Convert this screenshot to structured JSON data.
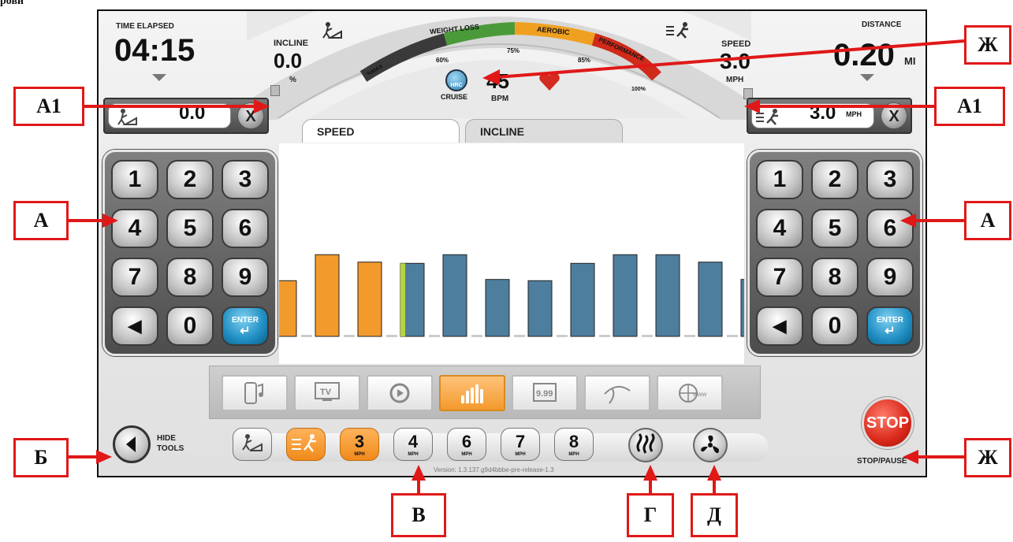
{
  "top_left_fragment": "рови",
  "time_elapsed": {
    "label": "TIME ELAPSED",
    "value": "04:15"
  },
  "incline": {
    "label": "INCLINE",
    "value": "0.0",
    "unit": "%"
  },
  "speed": {
    "label": "SPEED",
    "value": "3.0",
    "unit": "MPH"
  },
  "distance": {
    "label": "DISTANCE",
    "value": "0.20",
    "unit": "MI"
  },
  "hr_gauge": {
    "zones": [
      "WEIGHT LOSS",
      "AEROBIC",
      "PERFORMANCE"
    ],
    "ticks": [
      "%MAX",
      "60%",
      "75%",
      "85%",
      "100%"
    ],
    "cruise_label": "CRUISE",
    "hrc_label": "HRC",
    "bpm_value": "45",
    "bpm_label": "BPM",
    "zone_colors": [
      "#3a3a3a",
      "#4a9a3a",
      "#f0a020",
      "#d02a1a"
    ]
  },
  "left_readout": {
    "value": "0.0",
    "close": "X"
  },
  "right_readout": {
    "value": "3.0",
    "unit": "MPH",
    "close": "X"
  },
  "tabs": [
    {
      "label": "SPEED",
      "active": true
    },
    {
      "label": "INCLINE",
      "active": false
    }
  ],
  "keypad": {
    "keys": [
      "1",
      "2",
      "3",
      "4",
      "5",
      "6",
      "7",
      "8",
      "9",
      "◀",
      "0"
    ],
    "enter": "ENTER"
  },
  "chart_data": {
    "type": "bar",
    "values": [
      45,
      66,
      60,
      59,
      66,
      46,
      45,
      59,
      66,
      66,
      60,
      46
    ],
    "colors": [
      "#f39a2d",
      "#f39a2d",
      "#f39a2d",
      "#4e7e9e",
      "#4e7e9e",
      "#4e7e9e",
      "#4e7e9e",
      "#4e7e9e",
      "#4e7e9e",
      "#4e7e9e",
      "#4e7e9e",
      "#4e7e9e"
    ],
    "current_index": 3
  },
  "apps": [
    "music",
    "tv",
    "replay",
    "workout-chart",
    "score",
    "route-map",
    "web"
  ],
  "hide_tools": {
    "line1": "HIDE",
    "line2": "TOOLS"
  },
  "quick_speeds": [
    {
      "value": "3",
      "unit": "MPH",
      "active": true
    },
    {
      "value": "4",
      "unit": "MPH",
      "active": false
    },
    {
      "value": "6",
      "unit": "MPH",
      "active": false
    },
    {
      "value": "7",
      "unit": "MPH",
      "active": false
    },
    {
      "value": "8",
      "unit": "MPH",
      "active": false
    }
  ],
  "version": "Version: 1.3.137.g9d4bbbe-pre-release-1.3",
  "stop": {
    "label": "STOP",
    "sublabel": "STOP/PAUSE"
  },
  "callouts": {
    "a1_left": "А1",
    "a1_right": "А1",
    "a_left": "А",
    "a_right": "А",
    "zh_top": "Ж",
    "zh_bottom": "Ж",
    "b": "Б",
    "v": "В",
    "g": "Г",
    "d": "Д"
  },
  "annotation_color": "#e01818"
}
